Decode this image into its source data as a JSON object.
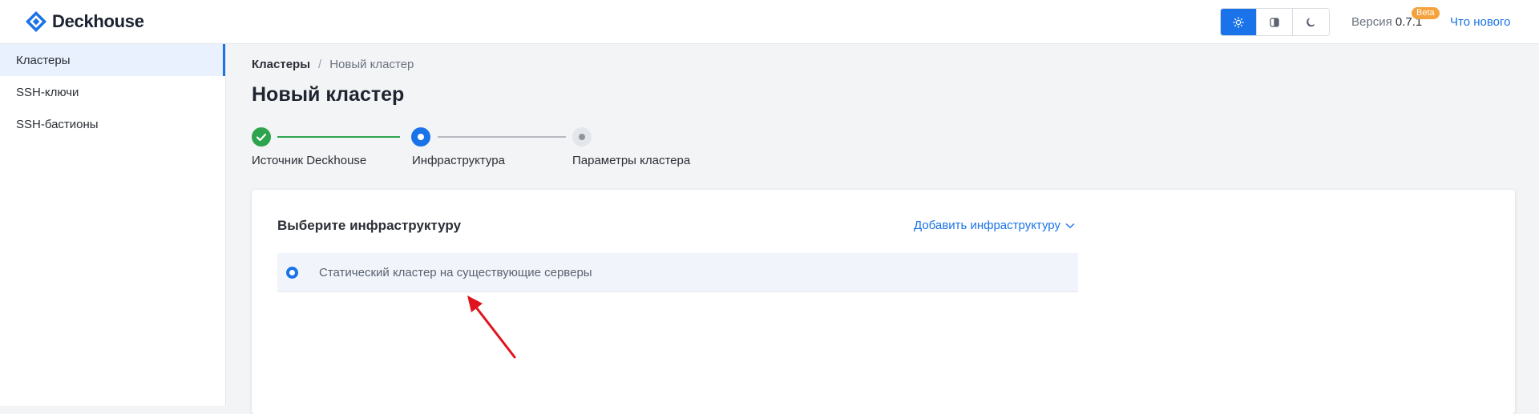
{
  "header": {
    "logo_text": "Deckhouse",
    "theme_buttons": [
      {
        "name": "light",
        "icon": "sun-icon",
        "active": true
      },
      {
        "name": "auto",
        "icon": "auto-theme-icon",
        "active": false
      },
      {
        "name": "dark",
        "icon": "moon-icon",
        "active": false
      }
    ],
    "version_label": "Версия",
    "version_value": "0.7.1",
    "beta_badge": "Beta",
    "whats_new": "Что нового"
  },
  "sidebar": {
    "items": [
      {
        "label": "Кластеры",
        "active": true
      },
      {
        "label": "SSH-ключи",
        "active": false
      },
      {
        "label": "SSH-бастионы",
        "active": false
      }
    ]
  },
  "breadcrumb": {
    "first": "Кластеры",
    "separator": "/",
    "current": "Новый кластер"
  },
  "page_title": "Новый кластер",
  "stepper": {
    "steps": [
      {
        "label": "Источник Deckhouse",
        "status": "completed"
      },
      {
        "label": "Инфраструктура",
        "status": "current"
      },
      {
        "label": "Параметры кластера",
        "status": "pending"
      }
    ]
  },
  "infra_card": {
    "title": "Выберите инфраструктуру",
    "add_button": "Добавить инфраструктуру",
    "options": [
      {
        "label": "Статический кластер на существующие серверы",
        "selected": true
      }
    ]
  },
  "colors": {
    "accent": "#1a73e8",
    "success": "#2ea44f",
    "beta_badge": "#f5a13c",
    "annotation_arrow": "#e0141e"
  }
}
